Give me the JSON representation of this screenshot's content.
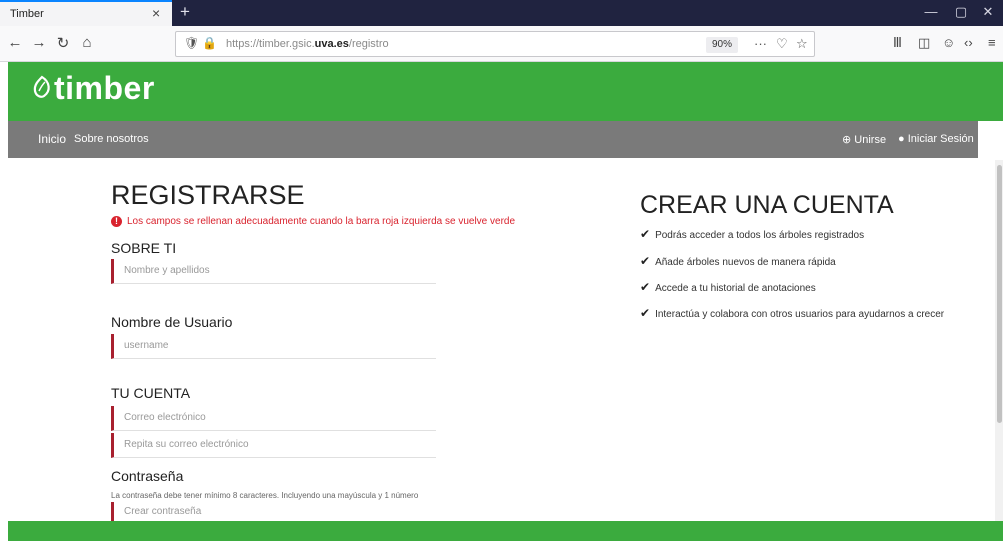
{
  "browser": {
    "tab_title": "Timber",
    "tab_close": "×",
    "new_tab": "+",
    "url_prefix": "https://timber.gsic.",
    "url_domain": "uva.es",
    "url_suffix": "/registro",
    "zoom": "90%",
    "win_min": "—",
    "win_max": "▢",
    "win_close": "✕",
    "back": "←",
    "forward": "→",
    "reload": "↻",
    "home": "⌂",
    "more": "···",
    "pocket": "♡",
    "bookmark": "☆",
    "library": "Ⅲ",
    "sidebar": "◫",
    "account": "☺",
    "devtools": "‹›",
    "menu": "≡"
  },
  "site": {
    "logo": "timber",
    "nav_home": "Inicio",
    "nav_about": "Sobre nosotros",
    "join": "Unirse",
    "login": "Iniciar Sesión"
  },
  "form": {
    "title": "REGISTRARSE",
    "alert": "Los campos se rellenan adecuadamente cuando la barra roja izquierda se vuelve verde",
    "sec_about": "SOBRE TI",
    "name_placeholder": "Nombre y apellidos",
    "sec_username": "Nombre de Usuario",
    "username_placeholder": "username",
    "sec_account": "TU CUENTA",
    "email_placeholder": "Correo electrónico",
    "email_repeat_placeholder": "Repita su correo electrónico",
    "sec_password": "Contraseña",
    "password_hint": "La contraseña debe tener mínimo 8 caracteres. Incluyendo una mayúscula y 1 número",
    "password_placeholder": "Crear contraseña"
  },
  "panel": {
    "title": "CREAR UNA CUENTA",
    "features": [
      "Podrás acceder a todos los árboles registrados",
      "Añade árboles nuevos de manera rápida",
      "Accede a tu historial de anotaciones",
      "Interactúa y colabora con otros usuarios para ayudarnos a crecer"
    ]
  },
  "colors": {
    "brand_green": "#3bab3e",
    "nav_gray": "#7a7a7a",
    "field_marker": "#a8202f",
    "alert_red": "#d9232e"
  }
}
